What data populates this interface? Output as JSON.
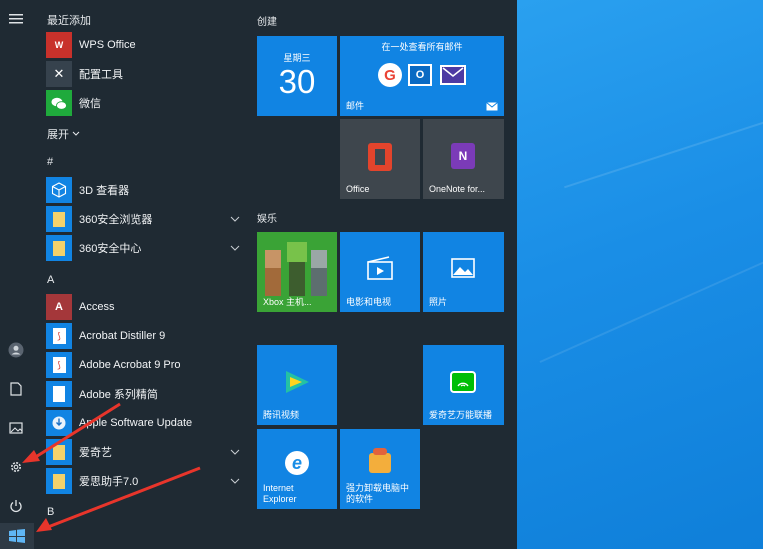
{
  "app_list": {
    "recent_header": "最近添加",
    "recent": [
      {
        "label": "WPS Office",
        "icon": "wps-icon"
      },
      {
        "label": "配置工具",
        "icon": "config-tool-icon"
      },
      {
        "label": "微信",
        "icon": "wechat-icon"
      }
    ],
    "expand_label": "展开",
    "hash_header": "#",
    "hash_items": [
      {
        "label": "3D 查看器",
        "icon": "3d-viewer-icon"
      },
      {
        "label": "360安全浏览器",
        "icon": "folder-icon"
      },
      {
        "label": "360安全中心",
        "icon": "folder-icon"
      }
    ],
    "a_header": "A",
    "a_items": [
      {
        "label": "Access",
        "icon": "access-icon"
      },
      {
        "label": "Acrobat Distiller 9",
        "icon": "acrobat-distiller-icon"
      },
      {
        "label": "Adobe Acrobat 9 Pro",
        "icon": "adobe-acrobat-icon"
      },
      {
        "label": "Adobe 系列精简",
        "icon": "document-icon"
      },
      {
        "label": "Apple Software Update",
        "icon": "apple-update-icon"
      },
      {
        "label": "爱奇艺",
        "icon": "folder-icon"
      },
      {
        "label": "爱思助手7.0",
        "icon": "folder-icon"
      }
    ],
    "b_header": "B"
  },
  "tiles": {
    "create_title": "创建",
    "calendar": {
      "day": "星期三",
      "date": "30"
    },
    "mail": {
      "header": "在一处查看所有邮件",
      "label": "邮件"
    },
    "office": {
      "label": "Office"
    },
    "onenote": {
      "label": "OneNote for..."
    },
    "ent_title": "娱乐",
    "xbox": {
      "label": "Xbox 主机..."
    },
    "movies": {
      "label": "电影和电视"
    },
    "photos": {
      "label": "照片"
    },
    "tencent": {
      "label": "腾讯视频"
    },
    "iqiyi": {
      "label": "爱奇艺万能联播"
    },
    "ie": {
      "label_line1": "Internet",
      "label_line2": "Explorer"
    },
    "uninstall": {
      "label_line1": "强力卸载电脑中",
      "label_line2": "的软件"
    }
  },
  "colors": {
    "tile_blue": "#1184e3",
    "arrow_red": "#e8352b",
    "menu_bg": "#1f2a33"
  }
}
